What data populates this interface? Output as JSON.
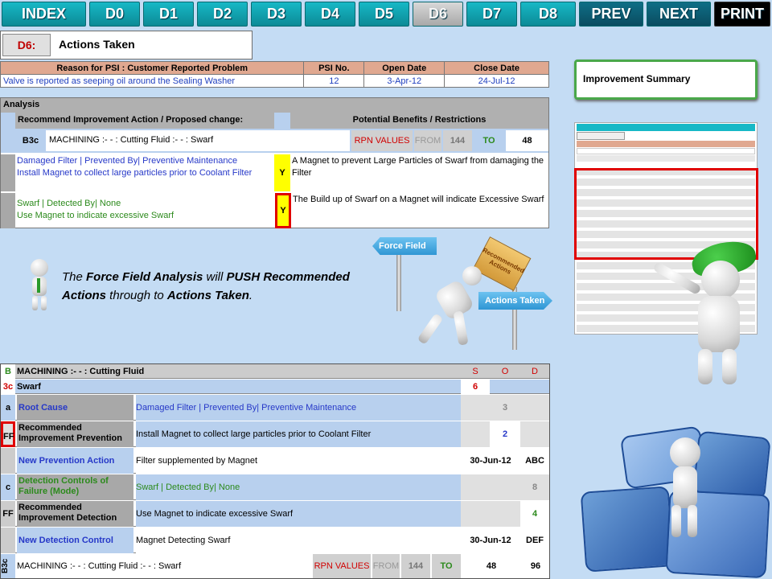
{
  "nav": {
    "items": [
      "INDEX",
      "D0",
      "D1",
      "D2",
      "D3",
      "D4",
      "D5",
      "D6",
      "D7",
      "D8",
      "PREV",
      "NEXT",
      "PRINT"
    ],
    "current": "D6"
  },
  "header": {
    "code": "D6:",
    "title": "Actions Taken"
  },
  "psi": {
    "reason_header": "Reason for PSI   : Customer Reported Problem",
    "psi_no_header": "PSI No.",
    "open_header": "Open Date",
    "close_header": "Close Date",
    "reason": "Valve is reported as seeping oil around the Sealing Washer",
    "psi_no": "12",
    "open_date": "3-Apr-12",
    "close_date": "24-Jul-12"
  },
  "analysis": {
    "title": "Analysis",
    "col_left": "Recommend Improvement Action / Proposed change:",
    "col_right": "Potential Benefits / Restrictions",
    "row_code": "B3c",
    "row_text": "MACHINING :- - :  Cutting Fluid :- - :  Swarf",
    "rpn_label": "RPN VALUES",
    "from_label": "FROM",
    "from_value": "144",
    "to_label": "TO",
    "to_value": "48",
    "rows": [
      {
        "action": "Damaged Filter | Prevented By| Preventive Maintenance\nInstall Magnet to collect large particles prior to Coolant Filter",
        "flag": "Y",
        "benefit": "A Magnet to prevent Large Particles of Swarf from damaging the Filter"
      },
      {
        "action": "Swarf | Detected By| None\nUse Magnet to indicate excessive Swarf",
        "flag": "Y",
        "benefit": "The Build up of Swarf on a Magnet will indicate Excessive Swarf"
      }
    ]
  },
  "improvement_summary": "Improvement Summary",
  "caption": {
    "p1": "The ",
    "b1": "Force Field Analysis",
    "p2": " will ",
    "b2": "PUSH Recommended Actions",
    "p3": " through to ",
    "b3": "Actions Taken",
    "p4": "."
  },
  "signs": {
    "force_field": "Force Field",
    "actions_taken": "Actions Taken",
    "box": "Recommended Actions"
  },
  "fmea": {
    "row_b_code": "B",
    "row_b_text": "MACHINING :- - :  Cutting Fluid",
    "s": "S",
    "o": "O",
    "d": "D",
    "row_3c_code": "3c",
    "row_3c_text": "Swarf",
    "row_3c_s": "6",
    "rows": [
      {
        "code": "a",
        "label": "Root Cause",
        "value": "Damaged Filter | Prevented By| Preventive Maintenance",
        "date": "",
        "o": "3",
        "d": ""
      },
      {
        "code": "FF",
        "label": "Recommended Improvement Prevention",
        "value": "Install Magnet to collect large particles prior to Coolant Filter",
        "date": "",
        "o": "2",
        "d": ""
      },
      {
        "code": "",
        "label": "New Prevention Action",
        "value": "Filter supplemented by Magnet",
        "date": "30-Jun-12",
        "o": "ABC",
        "d": ""
      },
      {
        "code": "c",
        "label": "Detection Controls of Failure (Mode)",
        "value": "Swarf | Detected By| None",
        "date": "",
        "o": "",
        "d": "8"
      },
      {
        "code": "FF",
        "label": "Recommended Improvement Detection",
        "value": "Use Magnet to indicate excessive Swarf",
        "date": "",
        "o": "",
        "d": "4"
      },
      {
        "code": "",
        "label": "New Detection Control",
        "value": "Magnet Detecting Swarf",
        "date": "30-Jun-12",
        "o": "DEF",
        "d": ""
      }
    ],
    "footer_code": "B3c",
    "footer_text": "MACHINING :- - :  Cutting Fluid :- - :  Swarf",
    "rpn_label": "RPN VALUES",
    "from_label": "FROM",
    "from_value": "144",
    "to_label": "TO",
    "to_value": "48",
    "end_value": "96"
  },
  "colors": {
    "accent": "#17b8c6",
    "red": "#e00000",
    "green": "#4aa84a"
  }
}
